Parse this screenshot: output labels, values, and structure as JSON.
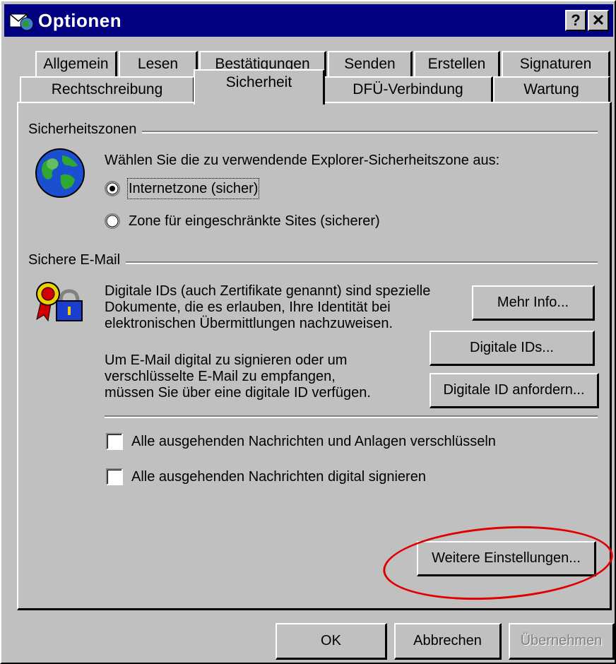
{
  "window": {
    "title": "Optionen",
    "help_btn": "?",
    "close_btn": "✕"
  },
  "tabs_back": [
    "Allgemein",
    "Lesen",
    "Bestätigungen",
    "Senden",
    "Erstellen",
    "Signaturen"
  ],
  "tabs_front": [
    "Rechtschreibung",
    "Sicherheit",
    "DFÜ-Verbindung",
    "Wartung"
  ],
  "security_zones": {
    "group_label": "Sicherheitszonen",
    "prompt": "Wählen Sie die zu verwendende Explorer-Sicherheitszone aus:",
    "option_internet": "Internetzone (sicher)",
    "option_restricted": "Zone für eingeschränkte Sites (sicherer)",
    "selected": "Internetzone (sicher)"
  },
  "secure_mail": {
    "group_label": "Sichere E-Mail",
    "desc1": [
      "Digitale IDs (auch Zertifikate genannt) sind spezielle",
      "Dokumente, die es erlauben, Ihre Identität bei",
      "elektronischen Übermittlungen nachzuweisen."
    ],
    "desc2": [
      "Um E-Mail digital zu signieren oder um",
      "verschlüsselte E-Mail zu empfangen,",
      "müssen Sie über eine digitale ID verfügen."
    ],
    "btn_more_info": "Mehr Info...",
    "btn_digital_ids": "Digitale IDs...",
    "btn_request_id": "Digitale ID anfordern...",
    "check_encrypt": "Alle ausgehenden Nachrichten und Anlagen verschlüsseln",
    "check_sign": "Alle ausgehenden Nachrichten digital signieren",
    "encrypt_checked": false,
    "sign_checked": false
  },
  "btn_advanced": "Weitere Einstellungen...",
  "footer": {
    "ok": "OK",
    "cancel": "Abbrechen",
    "apply": "Übernehmen"
  }
}
